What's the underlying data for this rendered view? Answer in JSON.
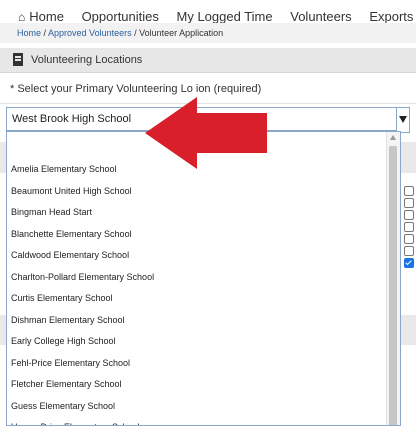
{
  "nav": {
    "home": "Home",
    "opportunities": "Opportunities",
    "logged_time": "My Logged Time",
    "volunteers": "Volunteers",
    "exports": "Exports"
  },
  "breadcrumb": {
    "home": "Home",
    "sep1": " / ",
    "approved": "Approved Volunteers",
    "sep2": " / ",
    "current": "Volunteer Application"
  },
  "panel": {
    "title": "Volunteering Locations"
  },
  "prompt": {
    "text": "* Select your Primary Volunteering Lo      ion (required)"
  },
  "select": {
    "value": "West Brook High School"
  },
  "options": [
    "Amelia Elementary School",
    "Beaumont United High School",
    "Bingman Head Start",
    "Blanchette Elementary School",
    "Caldwood Elementary School",
    "Charlton-Pollard Elementary School",
    "Curtis Elementary School",
    "Dishman Elementary School",
    "Early College High School",
    "Fehl-Price Elementary School",
    "Fletcher Elementary School",
    "Guess Elementary School",
    "Homer Drive Elementary School"
  ],
  "checkboxes": [
    false,
    false,
    false,
    false,
    false,
    false,
    true
  ],
  "colors": {
    "arrow": "#d81f2a",
    "select_border": "#8aa7c9",
    "checked": "#1a73e8"
  }
}
